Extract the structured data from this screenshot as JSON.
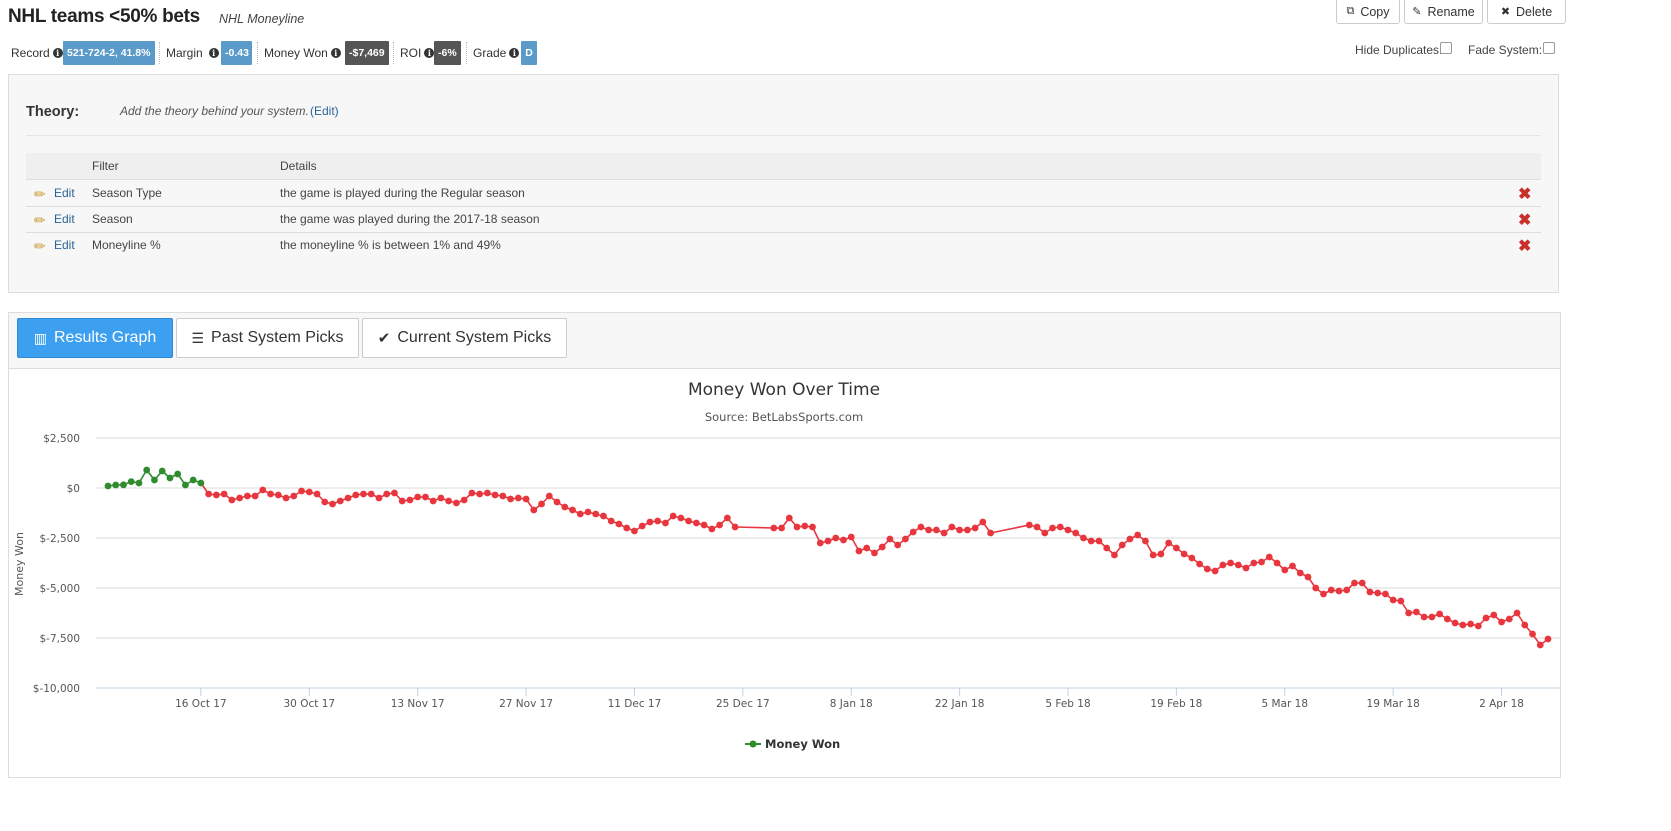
{
  "header": {
    "title": "NHL teams <50% bets",
    "subtitle": "NHL Moneyline",
    "buttons": {
      "copy": "Copy",
      "rename": "Rename",
      "delete": "Delete"
    }
  },
  "stats": {
    "record_label": "Record",
    "record_value": "521-724-2, 41.8%",
    "margin_label": "Margin",
    "margin_value": "-0.43",
    "money_won_label": "Money Won",
    "money_won_value": "-$7,469",
    "roi_label": "ROI",
    "roi_value": "-6%",
    "grade_label": "Grade",
    "grade_value": "D",
    "hide_duplicates_label": "Hide Duplicates:",
    "fade_system_label": "Fade System:"
  },
  "theory": {
    "label": "Theory:",
    "text": "Add the theory behind your system.",
    "edit": "(Edit)"
  },
  "filters": {
    "headers": {
      "filter": "Filter",
      "details": "Details"
    },
    "edit_label": "Edit",
    "rows": [
      {
        "name": "Season Type",
        "details": "the game is played during the Regular season"
      },
      {
        "name": "Season",
        "details": "the game was played during the 2017-18 season"
      },
      {
        "name": "Moneyline %",
        "details": "the moneyline % is between 1% and 49%"
      }
    ]
  },
  "tabs": {
    "results_graph": "Results Graph",
    "past_picks": "Past System Picks",
    "current_picks": "Current System Picks"
  },
  "colors": {
    "accent": "#3c9ff0",
    "badge_blue": "#5b9bc9",
    "badge_dark": "#555555",
    "positive": "#2e8b2e",
    "negative": "#e8363f"
  },
  "chart_data": {
    "type": "line",
    "title": "Money Won Over Time",
    "subtitle": "Source: BetLabsSports.com",
    "ylabel": "Money Won",
    "xlabel": "",
    "ylim": [
      -10000,
      2500
    ],
    "yticks": [
      2500,
      0,
      -2500,
      -5000,
      -7500,
      -10000
    ],
    "ytick_labels": [
      "$2,500",
      "$0",
      "$-2,500",
      "$-5,000",
      "$-7,500",
      "$-10,000"
    ],
    "xrange": [
      "2017-10-04",
      "2018-04-08"
    ],
    "xticks": [
      "2017-10-16",
      "2017-10-30",
      "2017-11-13",
      "2017-11-27",
      "2017-12-11",
      "2017-12-25",
      "2018-01-08",
      "2018-01-22",
      "2018-02-05",
      "2018-02-19",
      "2018-03-05",
      "2018-03-19",
      "2018-04-02"
    ],
    "xtick_labels": [
      "16 Oct 17",
      "30 Oct 17",
      "13 Nov 17",
      "27 Nov 17",
      "11 Dec 17",
      "25 Dec 17",
      "8 Jan 18",
      "22 Jan 18",
      "5 Feb 18",
      "19 Feb 18",
      "5 Mar 18",
      "19 Mar 18",
      "2 Apr 18"
    ],
    "grid": true,
    "legend": "bottom-center",
    "series": [
      {
        "name": "Money Won",
        "points": [
          [
            "2017-10-04",
            100
          ],
          [
            "2017-10-05",
            150
          ],
          [
            "2017-10-06",
            160
          ],
          [
            "2017-10-07",
            320
          ],
          [
            "2017-10-08",
            250
          ],
          [
            "2017-10-09",
            900
          ],
          [
            "2017-10-10",
            400
          ],
          [
            "2017-10-11",
            850
          ],
          [
            "2017-10-12",
            500
          ],
          [
            "2017-10-13",
            700
          ],
          [
            "2017-10-14",
            150
          ],
          [
            "2017-10-15",
            400
          ],
          [
            "2017-10-16",
            250
          ],
          [
            "2017-10-17",
            -300
          ],
          [
            "2017-10-18",
            -350
          ],
          [
            "2017-10-19",
            -300
          ],
          [
            "2017-10-20",
            -600
          ],
          [
            "2017-10-21",
            -500
          ],
          [
            "2017-10-22",
            -400
          ],
          [
            "2017-10-23",
            -400
          ],
          [
            "2017-10-24",
            -100
          ],
          [
            "2017-10-25",
            -300
          ],
          [
            "2017-10-26",
            -350
          ],
          [
            "2017-10-27",
            -500
          ],
          [
            "2017-10-28",
            -400
          ],
          [
            "2017-10-29",
            -150
          ],
          [
            "2017-10-30",
            -200
          ],
          [
            "2017-10-31",
            -300
          ],
          [
            "2017-11-01",
            -700
          ],
          [
            "2017-11-02",
            -800
          ],
          [
            "2017-11-03",
            -650
          ],
          [
            "2017-11-04",
            -500
          ],
          [
            "2017-11-05",
            -350
          ],
          [
            "2017-11-06",
            -300
          ],
          [
            "2017-11-07",
            -300
          ],
          [
            "2017-11-08",
            -500
          ],
          [
            "2017-11-09",
            -300
          ],
          [
            "2017-11-10",
            -250
          ],
          [
            "2017-11-11",
            -650
          ],
          [
            "2017-11-12",
            -600
          ],
          [
            "2017-11-13",
            -450
          ],
          [
            "2017-11-14",
            -450
          ],
          [
            "2017-11-15",
            -650
          ],
          [
            "2017-11-16",
            -500
          ],
          [
            "2017-11-17",
            -650
          ],
          [
            "2017-11-18",
            -750
          ],
          [
            "2017-11-19",
            -600
          ],
          [
            "2017-11-20",
            -250
          ],
          [
            "2017-11-21",
            -300
          ],
          [
            "2017-11-22",
            -250
          ],
          [
            "2017-11-23",
            -350
          ],
          [
            "2017-11-24",
            -400
          ],
          [
            "2017-11-25",
            -550
          ],
          [
            "2017-11-26",
            -500
          ],
          [
            "2017-11-27",
            -550
          ],
          [
            "2017-11-28",
            -1100
          ],
          [
            "2017-11-29",
            -800
          ],
          [
            "2017-11-30",
            -400
          ],
          [
            "2017-12-01",
            -700
          ],
          [
            "2017-12-02",
            -950
          ],
          [
            "2017-12-03",
            -1100
          ],
          [
            "2017-12-04",
            -1300
          ],
          [
            "2017-12-05",
            -1200
          ],
          [
            "2017-12-06",
            -1300
          ],
          [
            "2017-12-07",
            -1400
          ],
          [
            "2017-12-08",
            -1650
          ],
          [
            "2017-12-09",
            -1800
          ],
          [
            "2017-12-10",
            -2000
          ],
          [
            "2017-12-11",
            -2150
          ],
          [
            "2017-12-12",
            -1900
          ],
          [
            "2017-12-13",
            -1700
          ],
          [
            "2017-12-14",
            -1650
          ],
          [
            "2017-12-15",
            -1750
          ],
          [
            "2017-12-16",
            -1400
          ],
          [
            "2017-12-17",
            -1500
          ],
          [
            "2017-12-18",
            -1650
          ],
          [
            "2017-12-19",
            -1750
          ],
          [
            "2017-12-20",
            -1850
          ],
          [
            "2017-12-21",
            -2050
          ],
          [
            "2017-12-22",
            -1850
          ],
          [
            "2017-12-23",
            -1500
          ],
          [
            "2017-12-24",
            -1950
          ],
          [
            "2017-12-29",
            -2000
          ],
          [
            "2017-12-30",
            -2000
          ],
          [
            "2017-12-31",
            -1500
          ],
          [
            "2018-01-01",
            -1950
          ],
          [
            "2018-01-02",
            -1900
          ],
          [
            "2018-01-03",
            -1950
          ],
          [
            "2018-01-04",
            -2750
          ],
          [
            "2018-01-05",
            -2650
          ],
          [
            "2018-01-06",
            -2500
          ],
          [
            "2018-01-07",
            -2600
          ],
          [
            "2018-01-08",
            -2450
          ],
          [
            "2018-01-09",
            -3150
          ],
          [
            "2018-01-10",
            -3000
          ],
          [
            "2018-01-11",
            -3250
          ],
          [
            "2018-01-12",
            -2950
          ],
          [
            "2018-01-13",
            -2550
          ],
          [
            "2018-01-14",
            -2850
          ],
          [
            "2018-01-15",
            -2550
          ],
          [
            "2018-01-16",
            -2200
          ],
          [
            "2018-01-17",
            -1950
          ],
          [
            "2018-01-18",
            -2100
          ],
          [
            "2018-01-19",
            -2100
          ],
          [
            "2018-01-20",
            -2250
          ],
          [
            "2018-01-21",
            -1950
          ],
          [
            "2018-01-22",
            -2100
          ],
          [
            "2018-01-23",
            -2100
          ],
          [
            "2018-01-24",
            -2000
          ],
          [
            "2018-01-25",
            -1700
          ],
          [
            "2018-01-26",
            -2250
          ],
          [
            "2018-01-31",
            -1850
          ],
          [
            "2018-02-01",
            -1950
          ],
          [
            "2018-02-02",
            -2250
          ],
          [
            "2018-02-03",
            -2000
          ],
          [
            "2018-02-04",
            -1950
          ],
          [
            "2018-02-05",
            -2100
          ],
          [
            "2018-02-06",
            -2250
          ],
          [
            "2018-02-07",
            -2500
          ],
          [
            "2018-02-08",
            -2650
          ],
          [
            "2018-02-09",
            -2650
          ],
          [
            "2018-02-10",
            -3000
          ],
          [
            "2018-02-11",
            -3350
          ],
          [
            "2018-02-12",
            -2850
          ],
          [
            "2018-02-13",
            -2550
          ],
          [
            "2018-02-14",
            -2350
          ],
          [
            "2018-02-15",
            -2650
          ],
          [
            "2018-02-16",
            -3350
          ],
          [
            "2018-02-17",
            -3300
          ],
          [
            "2018-02-18",
            -2750
          ],
          [
            "2018-02-19",
            -3000
          ],
          [
            "2018-02-20",
            -3300
          ],
          [
            "2018-02-21",
            -3500
          ],
          [
            "2018-02-22",
            -3800
          ],
          [
            "2018-02-23",
            -4050
          ],
          [
            "2018-02-24",
            -4150
          ],
          [
            "2018-02-25",
            -3850
          ],
          [
            "2018-02-26",
            -3750
          ],
          [
            "2018-02-27",
            -3850
          ],
          [
            "2018-02-28",
            -4000
          ],
          [
            "2018-03-01",
            -3750
          ],
          [
            "2018-03-02",
            -3700
          ],
          [
            "2018-03-03",
            -3450
          ],
          [
            "2018-03-04",
            -3750
          ],
          [
            "2018-03-05",
            -4100
          ],
          [
            "2018-03-06",
            -3900
          ],
          [
            "2018-03-07",
            -4250
          ],
          [
            "2018-03-08",
            -4450
          ],
          [
            "2018-03-09",
            -5000
          ],
          [
            "2018-03-10",
            -5300
          ],
          [
            "2018-03-11",
            -5100
          ],
          [
            "2018-03-12",
            -5150
          ],
          [
            "2018-03-13",
            -5100
          ],
          [
            "2018-03-14",
            -4750
          ],
          [
            "2018-03-15",
            -4750
          ],
          [
            "2018-03-16",
            -5200
          ],
          [
            "2018-03-17",
            -5250
          ],
          [
            "2018-03-18",
            -5300
          ],
          [
            "2018-03-19",
            -5600
          ],
          [
            "2018-03-20",
            -5650
          ],
          [
            "2018-03-21",
            -6250
          ],
          [
            "2018-03-22",
            -6200
          ],
          [
            "2018-03-23",
            -6450
          ],
          [
            "2018-03-24",
            -6450
          ],
          [
            "2018-03-25",
            -6300
          ],
          [
            "2018-03-26",
            -6550
          ],
          [
            "2018-03-27",
            -6750
          ],
          [
            "2018-03-28",
            -6850
          ],
          [
            "2018-03-29",
            -6800
          ],
          [
            "2018-03-30",
            -6900
          ],
          [
            "2018-03-31",
            -6500
          ],
          [
            "2018-04-01",
            -6350
          ],
          [
            "2018-04-02",
            -6700
          ],
          [
            "2018-04-03",
            -6550
          ],
          [
            "2018-04-04",
            -6250
          ],
          [
            "2018-04-05",
            -6850
          ],
          [
            "2018-04-06",
            -7300
          ],
          [
            "2018-04-07",
            -7850
          ],
          [
            "2018-04-08",
            -7550
          ]
        ]
      }
    ]
  }
}
